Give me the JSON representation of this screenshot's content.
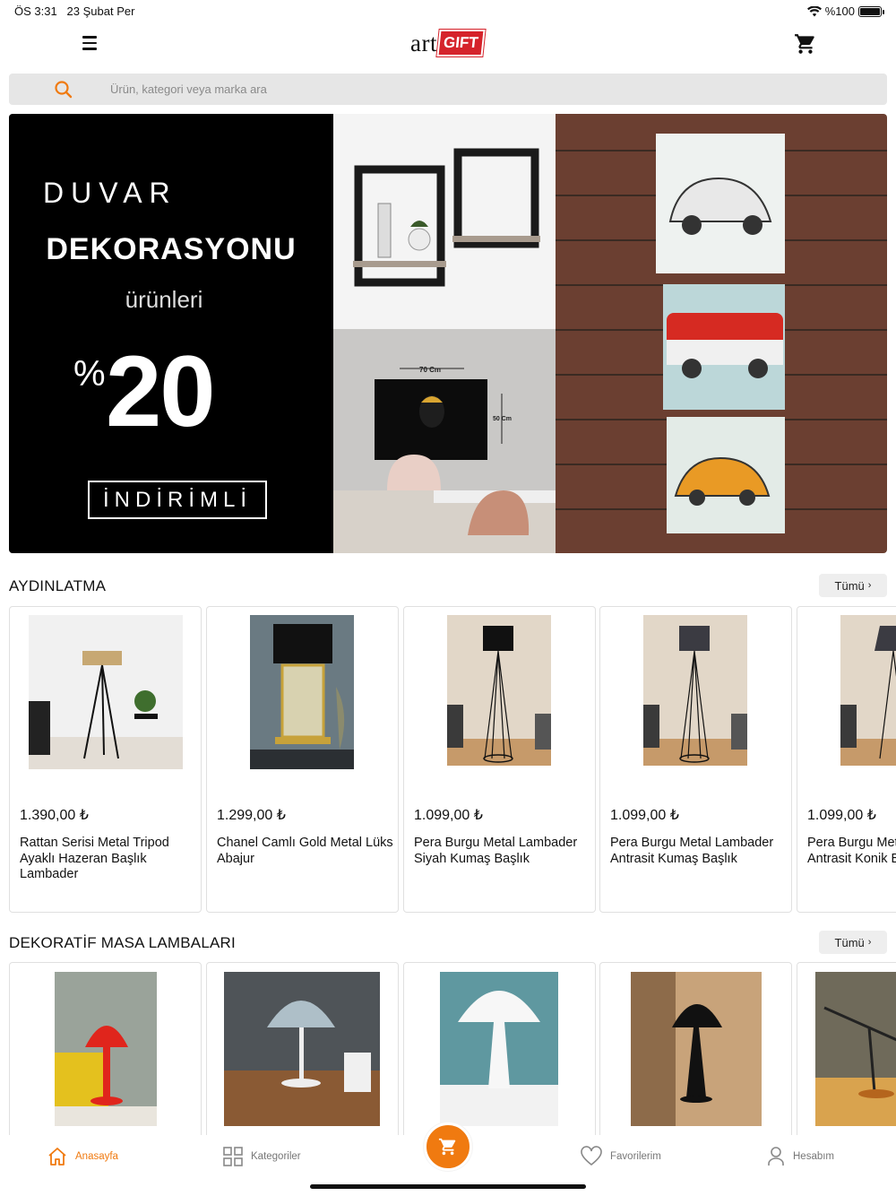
{
  "status_bar": {
    "time": "ÖS 3:31",
    "date": "23 Şubat Per",
    "battery": "%100"
  },
  "header": {
    "logo_text_art": "art",
    "logo_text_gift": "GIFT",
    "icons": [
      "menu-icon",
      "cart-icon"
    ]
  },
  "search": {
    "placeholder": "Ürün, kategori veya marka ara"
  },
  "banner": {
    "line1": "DUVAR",
    "line2": "DEKORASYONU",
    "line3": "ürünleri",
    "percent_sign": "%",
    "percent_value": "20",
    "badge": "İNDİRİMLİ",
    "dimension_width": "70 Cm",
    "dimension_height": "50 Cm"
  },
  "sections": [
    {
      "title": "AYDINLATMA",
      "all_label": "Tümü",
      "products": [
        {
          "price": "1.390,00 ₺",
          "title": "Rattan Serisi Metal Tripod Ayaklı Hazeran Başlık Lambader"
        },
        {
          "price": "1.299,00 ₺",
          "title": "Chanel Camlı Gold Metal Lüks Abajur"
        },
        {
          "price": "1.099,00 ₺",
          "title": "Pera Burgu Metal Lambader Siyah Kumaş Başlık"
        },
        {
          "price": "1.099,00 ₺",
          "title": "Pera Burgu Metal Lambader Antrasit Kumaş Başlık"
        },
        {
          "price": "1.099,00 ₺",
          "title": "Pera Burgu Metal Lambader Antrasit Konik Başlık"
        }
      ]
    },
    {
      "title": "DEKORATİF MASA LAMBALARI",
      "all_label": "Tümü"
    }
  ],
  "tabbar": {
    "items": [
      {
        "label": "Anasayfa",
        "icon": "home-icon",
        "active": true
      },
      {
        "label": "Kategoriler",
        "icon": "grid-icon",
        "active": false
      },
      {
        "label": "Favorilerim",
        "icon": "heart-icon",
        "active": false
      },
      {
        "label": "Hesabım",
        "icon": "user-icon",
        "active": false
      }
    ],
    "center_icon": "cart-icon"
  },
  "colors": {
    "accent": "#f07a10",
    "logo_red": "#d5232b",
    "search_bg": "#e6e6e6"
  }
}
